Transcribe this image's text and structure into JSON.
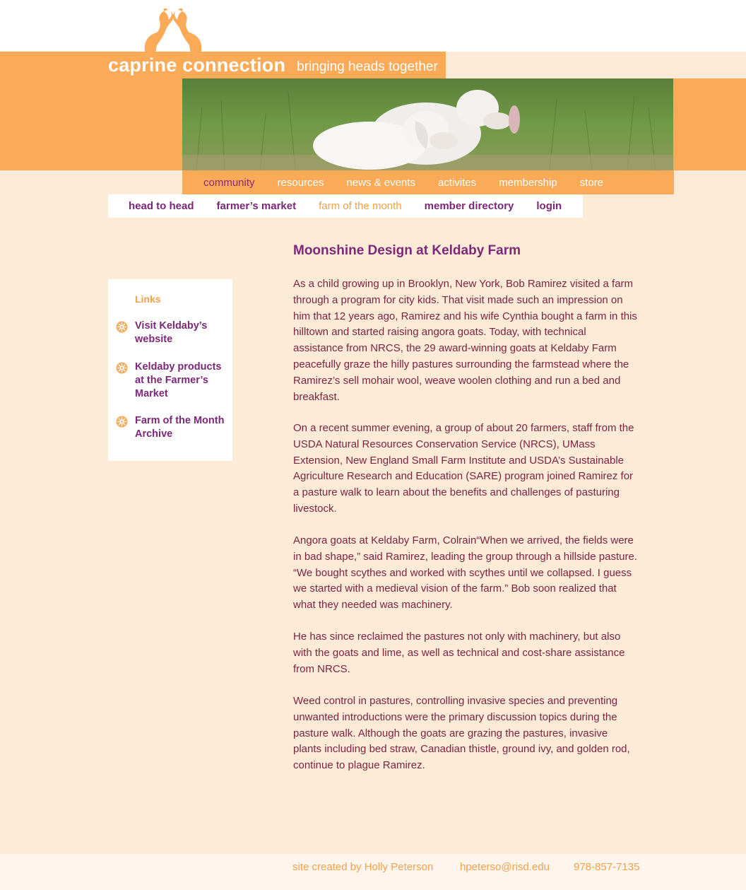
{
  "brand": {
    "name": "caprine connection",
    "tagline": "bringing heads together"
  },
  "main_nav": [
    "community",
    "resources",
    "news & events",
    "activites",
    "membership",
    "store"
  ],
  "sub_nav": [
    "head to head",
    "farmer’s market",
    "farm of the month",
    "member directory",
    "login"
  ],
  "sidebar": {
    "title": "Links",
    "links": [
      "Visit Keldaby’s website",
      "Keldaby products at the Farmer’s Market",
      "Farm of the Month Archive"
    ]
  },
  "article": {
    "title": "Moonshine Design at Keldaby Farm",
    "paragraphs": [
      "As a child growing up in Brooklyn, New York, Bob Ramirez visited a farm through a program for city kids. That visit made such an impression on him that 12 years ago, Ramirez and his wife Cynthia bought a farm in this hilltown and started raising angora goats. Today, with technical assistance from NRCS, the 29 award-winning goats at Keldaby Farm peacefully graze the hilly pastures surrounding the farmstead where the Ramirez’s sell mohair wool, weave woolen clothing and run a bed and breakfast.",
      "On a recent summer evening, a group of about 20 farmers, staff from the USDA Natural Resources Conservation Service (NRCS), UMass Extension, New England Small Farm Institute and USDA’s Sustainable Agriculture Research and Education (SARE) program joined Ramirez for a pasture walk to learn about the benefits and challenges of pasturing livestock.",
      "Angora goats at Keldaby Farm, Colrain“When we arrived, the fields were in bad shape,” said Ramirez, leading the group through a hillside pasture. “We bought scythes and worked with scythes until we collapsed. I guess we started with a medieval vision of the farm.” Bob soon realized that what they needed was machinery.",
      "He has since reclaimed the pastures not only with machinery, but also with the goats and lime, as well as technical and cost-share assistance from NRCS.",
      "Weed control in pastures, controlling invasive species and preventing unwanted introductions were the primary discussion topics during the pasture walk. Although the goats are grazing the pastures, invasive plants including bed straw, Canadian thistle, ground ivy, and golden rod, continue to plague Ramirez."
    ]
  },
  "footer": {
    "credit": "site created by Holly Peterson",
    "email": "hpeterso@risd.edu",
    "phone": "978-857-7135"
  },
  "colors": {
    "orange": "#fbaa58",
    "cream": "#fdebd8",
    "purple": "#7a2877",
    "text": "#7a2440"
  }
}
